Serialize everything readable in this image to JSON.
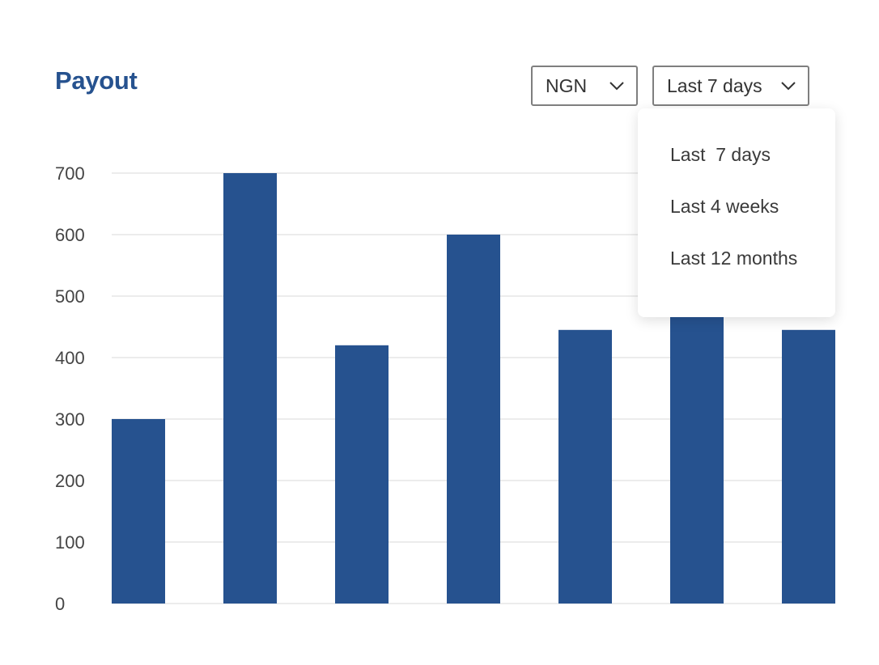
{
  "header": {
    "title": "Payout"
  },
  "filters": {
    "currency": {
      "selected": "NGN"
    },
    "range": {
      "selected": "Last 7 days",
      "options": [
        "Last  7 days",
        "Last 4 weeks",
        "Last 12 months"
      ]
    }
  },
  "colors": {
    "bar": "#26528f",
    "title": "#26528f",
    "grid": "#e6e6e6"
  },
  "chart_data": {
    "type": "bar",
    "title": "",
    "xlabel": "",
    "ylabel": "",
    "categories": [
      "",
      "",
      "",
      "",
      "",
      "",
      ""
    ],
    "values": [
      300,
      700,
      420,
      600,
      445,
      470,
      445
    ],
    "ylim": [
      0,
      700
    ],
    "yticks": [
      0,
      100,
      200,
      300,
      400,
      500,
      600,
      700
    ],
    "grid": true
  }
}
